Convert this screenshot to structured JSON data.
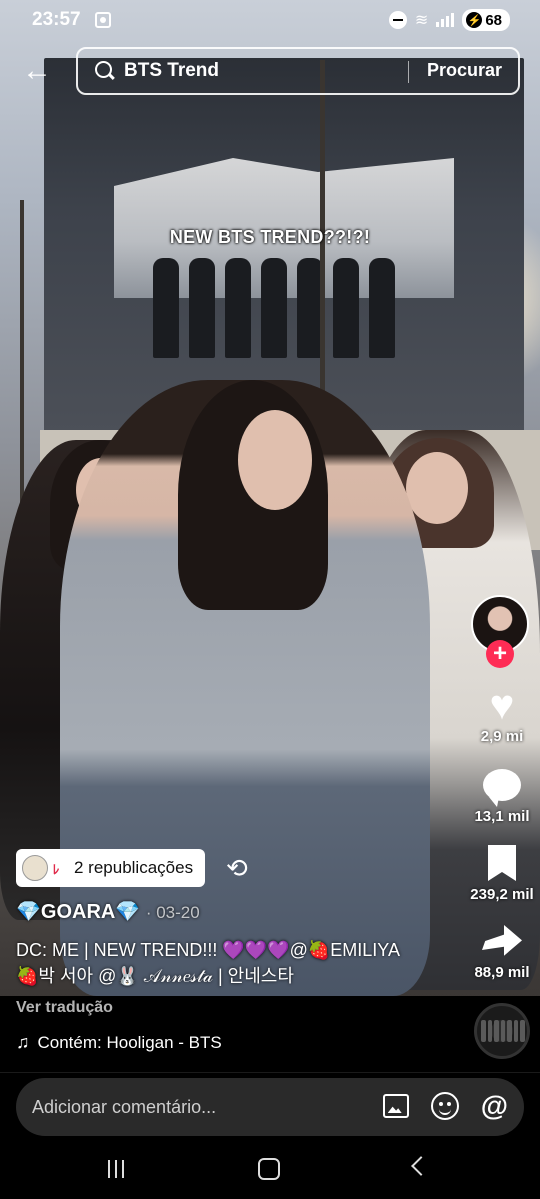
{
  "status_bar": {
    "time": "23:57",
    "battery": "68"
  },
  "search": {
    "query": "BTS Trend",
    "button_label": "Procurar"
  },
  "video": {
    "overlay_text": "NEW BTS TREND??!?!"
  },
  "actions": {
    "likes": "2,9 mi",
    "comments": "13,1 mil",
    "saves": "239,2 mil",
    "shares": "88,9 mil"
  },
  "repost": {
    "label": "2 republicações"
  },
  "post": {
    "author": "💎GOARA💎",
    "date": "· 03-20",
    "caption_line1": "DC: ME | NEW TREND!!! 💜💜💜@🍓EMILIYA",
    "caption_line2": "🍓박 서아 @🐰 𝒜𝓃𝓃𝑒𝓈𝓉𝒶 | 안네스타",
    "translate_label": "Ver tradução",
    "music": "Contém: Hooligan - BTS"
  },
  "comment_bar": {
    "placeholder": "Adicionar comentário..."
  },
  "colors": {
    "accent": "#fe2c55",
    "comment_bg": "#2a2a2a"
  },
  "icons": {
    "back": "arrow-left-icon",
    "search": "search-icon",
    "like": "heart-icon",
    "comment": "comment-bubble-icon",
    "save": "bookmark-icon",
    "share": "share-arrow-icon",
    "repost": "repost-icon",
    "music": "music-note-icon",
    "image": "image-icon",
    "emoji": "emoji-icon",
    "mention": "at-icon"
  }
}
